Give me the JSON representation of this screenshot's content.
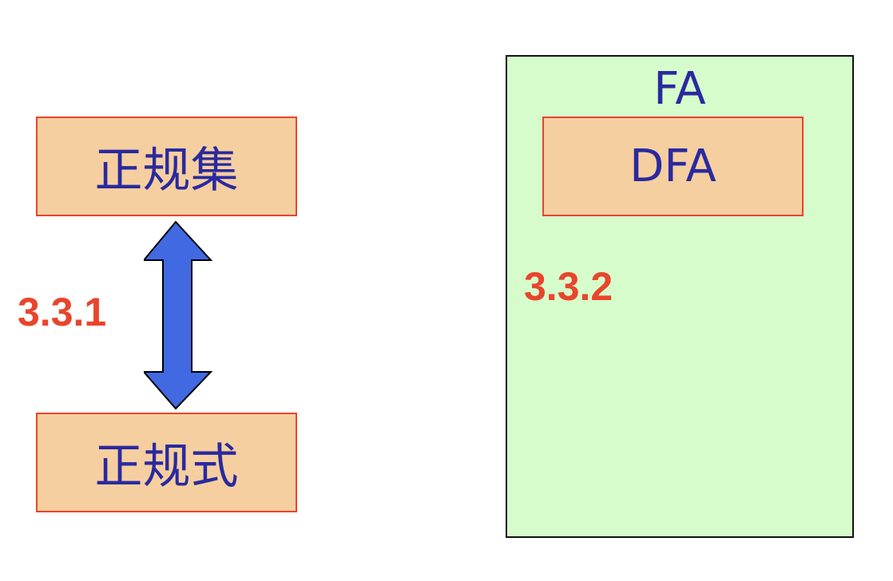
{
  "left": {
    "top_box": "正规集",
    "bottom_box": "正规式",
    "section": "3.3.1"
  },
  "right": {
    "outer_label": "FA",
    "inner_box": "DFA",
    "section": "3.3.2"
  },
  "colors": {
    "box_fill": "#f6cfa0",
    "box_border": "#e8452c",
    "text": "#2a2a9e",
    "section_number": "#e8452c",
    "fa_fill": "#d6fccc",
    "arrow": "#4169e1"
  },
  "icons": {
    "arrow": "double-headed-vertical-arrow"
  }
}
